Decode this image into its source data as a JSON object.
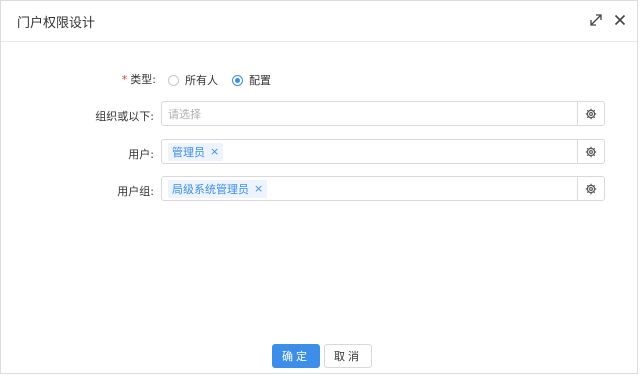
{
  "dialog": {
    "title": "门户权限设计"
  },
  "form": {
    "type": {
      "required_mark": "*",
      "label": "类型:",
      "options": [
        {
          "label": "所有人",
          "checked": false
        },
        {
          "label": "配置",
          "checked": true
        }
      ]
    },
    "org": {
      "label": "组织或以下:",
      "placeholder": "请选择"
    },
    "user": {
      "label": "用户:",
      "tags": [
        "管理员"
      ]
    },
    "user_group": {
      "label": "用户组:",
      "tags": [
        "局级系统管理员"
      ]
    },
    "tag_remove": "×"
  },
  "footer": {
    "ok_label": "确定",
    "cancel_label": "取消"
  },
  "colors": {
    "primary": "#3d8ee8",
    "required": "#e4393c"
  },
  "icons": [
    "expand-icon",
    "close-icon",
    "gear-icon",
    "tag-close-icon"
  ]
}
